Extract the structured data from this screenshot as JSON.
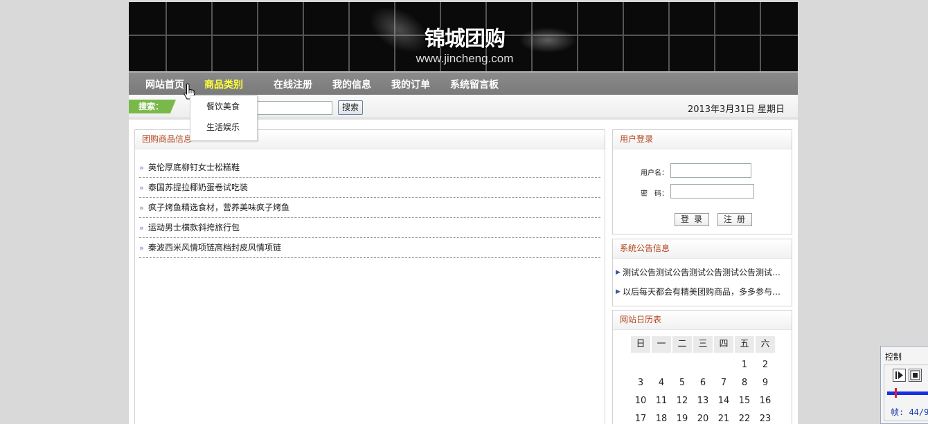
{
  "banner": {
    "title": "锦城团购",
    "url": "www.jincheng.com"
  },
  "nav": {
    "items": [
      "网站首页",
      "商品类别",
      "在线注册",
      "我的信息",
      "我的订单",
      "系统留言板"
    ],
    "active_color": "#ffff3a"
  },
  "dropdown": {
    "items": [
      "餐饮美食",
      "生活娱乐"
    ]
  },
  "search": {
    "label": "搜索：",
    "input_value": "",
    "button": "搜索"
  },
  "date": "2013年3月31日  星期日",
  "goods_panel": {
    "title": "团购商品信息",
    "items": [
      "英伦厚底柳钉女士松糕鞋",
      "泰国苏提拉椰奶蛋卷试吃装",
      "疯子烤鱼精选食材，营养美味疯子烤鱼",
      "运动男士横款斜挎旅行包",
      "秦波西米风情项链高档封皮风情项链"
    ]
  },
  "login_panel": {
    "title": "用户登录",
    "username_label": "用户名：",
    "password_label": "密　码：",
    "username_value": "",
    "password_value": "",
    "login_button": "登录",
    "register_button": "注册"
  },
  "notice_panel": {
    "title": "系统公告信息",
    "items": [
      "测试公告测试公告测试公告测试公告测试…",
      "以后每天都会有精美团购商品，多多参与…"
    ]
  },
  "calendar_panel": {
    "title": "网站日历表",
    "weekdays": [
      "日",
      "一",
      "二",
      "三",
      "四",
      "五",
      "六"
    ],
    "weeks": [
      [
        "",
        "",
        "",
        "",
        "",
        "1",
        "2"
      ],
      [
        "3",
        "4",
        "5",
        "6",
        "7",
        "8",
        "9"
      ],
      [
        "10",
        "11",
        "12",
        "13",
        "14",
        "15",
        "16"
      ],
      [
        "17",
        "18",
        "19",
        "20",
        "21",
        "22",
        "23"
      ]
    ]
  },
  "control_panel": {
    "title": "控制",
    "frame_text": "帧: 44/9"
  },
  "colors": {
    "panel_title": "#b4451c",
    "search_label_bg": "#79b94a",
    "nav_bg": "#808080",
    "progress_track": "#1b2ee0",
    "progress_thumb": "#e02020"
  },
  "icons": [
    "hand-pointer-icon",
    "double-chevron-icon",
    "arrow-right-icon",
    "play-icon",
    "stop-icon"
  ]
}
